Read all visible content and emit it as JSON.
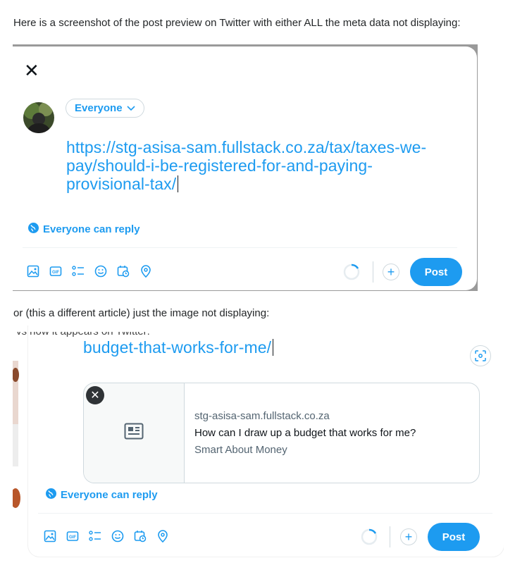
{
  "captions": {
    "first": "Here is a screenshot of the post preview on Twitter with either ALL the meta data not displaying:",
    "second": "or (this a different article) just the image not displaying:"
  },
  "shot1": {
    "audience_label": "Everyone",
    "post_text": "https://stg-asisa-sam.fullstack.co.za/tax/taxes-we-pay/should-i-be-registered-for-and-paying-provisional-tax/",
    "post_text_lines": [
      "https://stg-asisa-sam.fullstack.co.za/tax/taxes-we-",
      "pay/should-i-be-registered-for-and-paying-",
      "provisional-tax/"
    ],
    "reply_setting": "Everyone can reply",
    "post_button": "Post"
  },
  "shot2": {
    "cropped_header": "vs how it appears on Twitter:",
    "post_text_tail": "budget-that-works-for-me/",
    "link_card": {
      "domain": "stg-asisa-sam.fullstack.co.za",
      "title": "How can I draw up a budget that works for me?",
      "site_name": "Smart About Money"
    },
    "reply_setting": "Everyone can reply",
    "post_button": "Post"
  },
  "toolbar_icons": [
    "media-icon",
    "gif-icon",
    "poll-icon",
    "emoji-icon",
    "schedule-icon",
    "location-icon"
  ],
  "colors": {
    "accent": "#1d9bf0",
    "text": "#0f1419",
    "muted": "#536471",
    "border": "#cfd9de"
  }
}
